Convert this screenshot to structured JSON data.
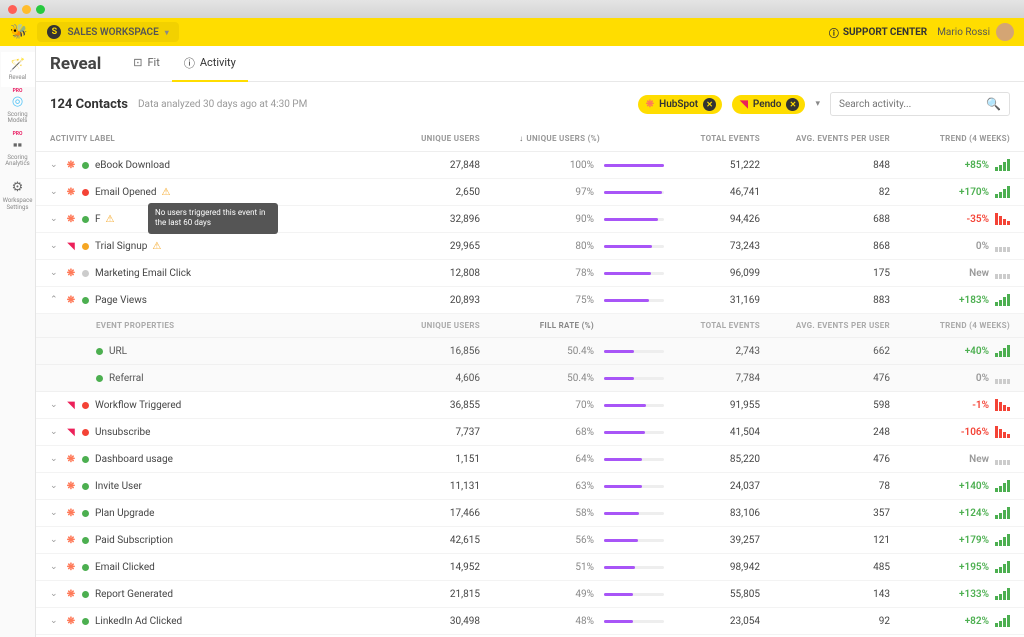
{
  "workspace": "SALES WORKSPACE",
  "support": "SUPPORT CENTER",
  "user": "Mario Rossi",
  "sidenav": [
    {
      "label": "Reveal"
    },
    {
      "label": "Scoring Models",
      "pro": true
    },
    {
      "label": "Scoring Analytics",
      "pro": true
    },
    {
      "label": "Workspace Settings"
    }
  ],
  "page_title": "Reveal",
  "tabs": [
    {
      "label": "Fit"
    },
    {
      "label": "Activity",
      "active": true
    }
  ],
  "contacts": "124 Contacts",
  "analyzed": "Data analyzed 30 days ago at 4:30 PM",
  "sources": [
    {
      "name": "HubSpot"
    },
    {
      "name": "Pendo"
    }
  ],
  "search_placeholder": "Search activity...",
  "cols": {
    "label": "ACTIVITY LABEL",
    "users": "UNIQUE USERS",
    "pct": "UNIQUE USERS (%)",
    "events": "TOTAL EVENTS",
    "avg": "AVG. EVENTS PER USER",
    "trend": "TREND (4 WEEKS)"
  },
  "sub_cols": {
    "label": "EVENT PROPERTIES",
    "users": "UNIQUE USERS",
    "pct": "FILL RATE (%)",
    "events": "TOTAL EVENTS",
    "avg": "AVG. EVENTS PER USER",
    "trend": "TREND (4 WEEKS)"
  },
  "tooltip": "No users triggered this event in the last 60 days",
  "rows": [
    {
      "src": "hs",
      "dot": "#4caf50",
      "name": "eBook Download",
      "users": "27,848",
      "pct": "100%",
      "bar": 100,
      "events": "51,222",
      "avg": "848",
      "trend": "+85%",
      "tclass": "pos"
    },
    {
      "src": "hs",
      "dot": "#f44336",
      "name": "Email Opened",
      "warn": true,
      "users": "2,650",
      "pct": "97%",
      "bar": 97,
      "events": "46,741",
      "avg": "82",
      "trend": "+170%",
      "tclass": "pos"
    },
    {
      "src": "hs",
      "dot": "#4caf50",
      "name": "F",
      "warn": true,
      "tooltip": true,
      "users": "32,896",
      "pct": "90%",
      "bar": 90,
      "events": "94,426",
      "avg": "688",
      "trend": "-35%",
      "tclass": "neg"
    },
    {
      "src": "pd",
      "dot": "#f5a623",
      "name": "Trial Signup",
      "warn": true,
      "users": "29,965",
      "pct": "80%",
      "bar": 80,
      "events": "73,243",
      "avg": "868",
      "trend": "0%",
      "tclass": "neu"
    },
    {
      "src": "hs",
      "dot": "#ccc",
      "name": "Marketing Email Click",
      "users": "12,808",
      "pct": "78%",
      "bar": 78,
      "events": "96,099",
      "avg": "175",
      "trend": "New",
      "tclass": "neu"
    },
    {
      "src": "hs",
      "dot": "#4caf50",
      "name": "Page Views",
      "expanded": true,
      "users": "20,893",
      "pct": "75%",
      "bar": 75,
      "events": "31,169",
      "avg": "883",
      "trend": "+183%",
      "tclass": "pos"
    },
    {
      "src": "pd",
      "dot": "#f44336",
      "name": "Workflow Triggered",
      "users": "36,855",
      "pct": "70%",
      "bar": 70,
      "events": "91,955",
      "avg": "598",
      "trend": "-1%",
      "tclass": "neg"
    },
    {
      "src": "pd",
      "dot": "#f44336",
      "name": "Unsubscribe",
      "users": "7,737",
      "pct": "68%",
      "bar": 68,
      "events": "41,504",
      "avg": "248",
      "trend": "-106%",
      "tclass": "neg"
    },
    {
      "src": "hs",
      "dot": "#4caf50",
      "name": "Dashboard usage",
      "users": "1,151",
      "pct": "64%",
      "bar": 64,
      "events": "85,220",
      "avg": "476",
      "trend": "New",
      "tclass": "neu"
    },
    {
      "src": "hs",
      "dot": "#4caf50",
      "name": "Invite User",
      "users": "11,131",
      "pct": "63%",
      "bar": 63,
      "events": "24,037",
      "avg": "78",
      "trend": "+140%",
      "tclass": "pos"
    },
    {
      "src": "hs",
      "dot": "#4caf50",
      "name": "Plan Upgrade",
      "users": "17,466",
      "pct": "58%",
      "bar": 58,
      "events": "83,106",
      "avg": "357",
      "trend": "+124%",
      "tclass": "pos"
    },
    {
      "src": "hs",
      "dot": "#4caf50",
      "name": "Paid Subscription",
      "users": "42,615",
      "pct": "56%",
      "bar": 56,
      "events": "39,257",
      "avg": "121",
      "trend": "+179%",
      "tclass": "pos"
    },
    {
      "src": "hs",
      "dot": "#4caf50",
      "name": "Email Clicked",
      "users": "14,952",
      "pct": "51%",
      "bar": 51,
      "events": "98,942",
      "avg": "485",
      "trend": "+195%",
      "tclass": "pos"
    },
    {
      "src": "hs",
      "dot": "#4caf50",
      "name": "Report Generated",
      "users": "21,815",
      "pct": "49%",
      "bar": 49,
      "events": "55,805",
      "avg": "143",
      "trend": "+133%",
      "tclass": "pos"
    },
    {
      "src": "hs",
      "dot": "#4caf50",
      "name": "LinkedIn Ad Clicked",
      "users": "30,498",
      "pct": "48%",
      "bar": 48,
      "events": "23,054",
      "avg": "92",
      "trend": "+82%",
      "tclass": "pos"
    }
  ],
  "sub_rows": [
    {
      "dot": "#4caf50",
      "name": "URL",
      "users": "16,856",
      "pct": "50.4%",
      "bar": 50,
      "events": "2,743",
      "avg": "662",
      "trend": "+40%",
      "tclass": "pos"
    },
    {
      "dot": "#4caf50",
      "name": "Referral",
      "users": "4,606",
      "pct": "50.4%",
      "bar": 50,
      "events": "7,784",
      "avg": "476",
      "trend": "0%",
      "tclass": "neu"
    }
  ]
}
